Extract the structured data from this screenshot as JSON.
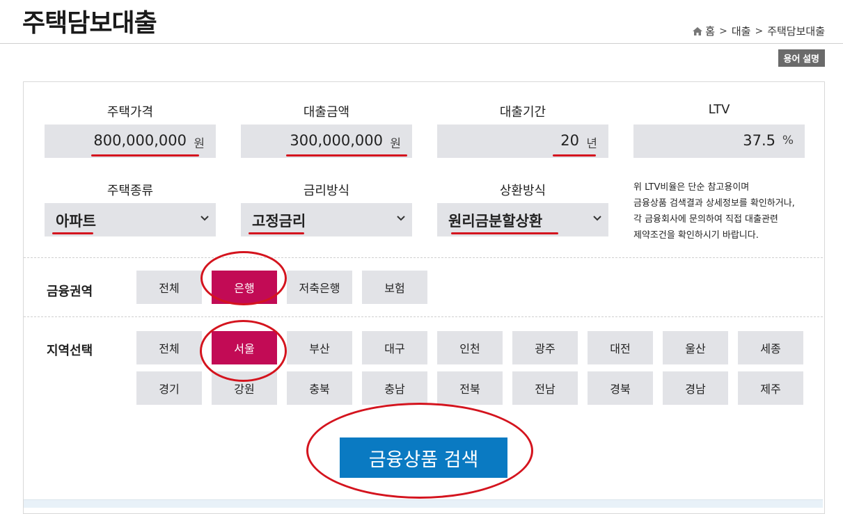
{
  "page_title": "주택담보대출",
  "breadcrumb": {
    "home_icon": "home-icon",
    "items": [
      "홈",
      "대출",
      "주택담보대출"
    ]
  },
  "glossary_button": "용어 설명",
  "fields": {
    "house_price": {
      "label": "주택가격",
      "value": "800,000,000",
      "unit": "원"
    },
    "loan_amount": {
      "label": "대출금액",
      "value": "300,000,000",
      "unit": "원"
    },
    "loan_period": {
      "label": "대출기간",
      "value": "20",
      "unit": "년"
    },
    "ltv": {
      "label": "LTV",
      "value": "37.5",
      "unit": "%"
    }
  },
  "selects": {
    "house_type": {
      "label": "주택종류",
      "value": "아파트"
    },
    "rate_type": {
      "label": "금리방식",
      "value": "고정금리"
    },
    "repayment": {
      "label": "상환방식",
      "value": "원리금분할상환"
    }
  },
  "notice": [
    "위 LTV비율은 단순 참고용이며",
    "금융상품 검색결과 상세정보를 확인하거나,",
    "각 금융회사에 문의하여 직접 대출관련",
    "제약조건을 확인하시기 바랍니다."
  ],
  "finance_sector": {
    "label": "금융권역",
    "options": [
      "전체",
      "은행",
      "저축은행",
      "보험"
    ],
    "selected": "은행"
  },
  "region": {
    "label": "지역선택",
    "options": [
      "전체",
      "서울",
      "부산",
      "대구",
      "인천",
      "광주",
      "대전",
      "울산",
      "세종",
      "경기",
      "강원",
      "충북",
      "충남",
      "전북",
      "전남",
      "경북",
      "경남",
      "제주"
    ],
    "selected": "서울"
  },
  "search_button": "금융상품 검색",
  "colors": {
    "accent": "#c20b55",
    "search_button": "#0a7ac2",
    "annotation": "#d4141e",
    "field_bg": "#e2e3e7"
  }
}
